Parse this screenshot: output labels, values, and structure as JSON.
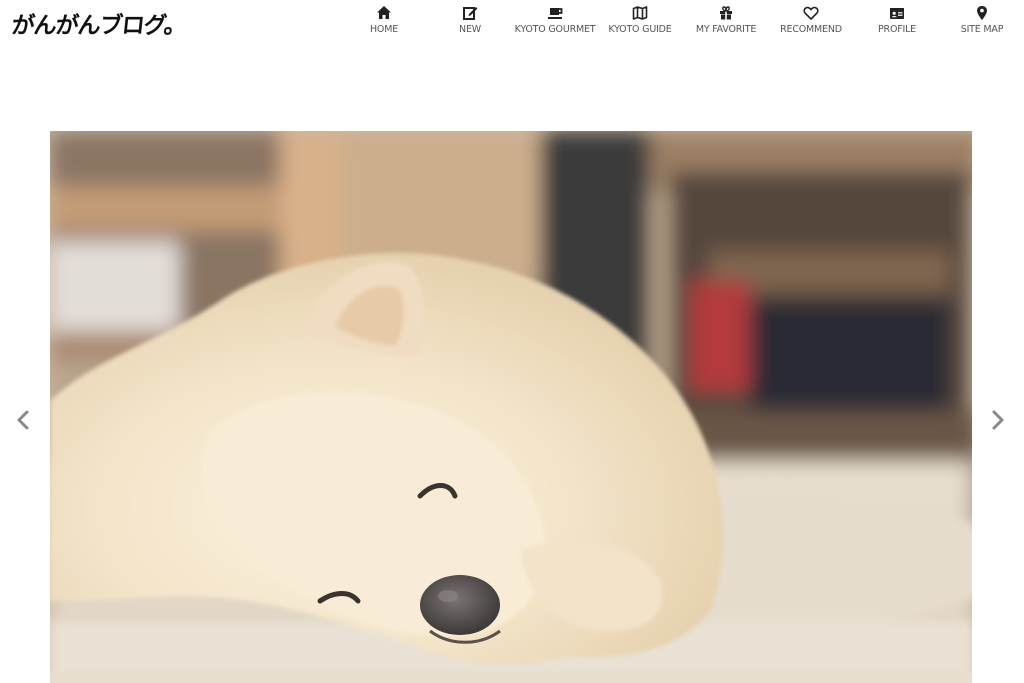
{
  "site": {
    "logo_text": "がんがんブログ。"
  },
  "nav": {
    "items": [
      {
        "label": "HOME",
        "icon": "home-icon"
      },
      {
        "label": "NEW",
        "icon": "edit-icon"
      },
      {
        "label": "KYOTO GOURMET",
        "icon": "coffee-icon"
      },
      {
        "label": "KYOTO GUIDE",
        "icon": "map-icon"
      },
      {
        "label": "MY FAVORITE",
        "icon": "gift-icon"
      },
      {
        "label": "RECOMMEND",
        "icon": "heart-icon"
      },
      {
        "label": "PROFILE",
        "icon": "id-card-icon"
      },
      {
        "label": "SITE MAP",
        "icon": "map-marker-icon"
      }
    ]
  },
  "slider": {
    "image_subject": "sleeping white pomeranian dog on carpet",
    "prev_icon": "chevron-left-icon",
    "next_icon": "chevron-right-icon"
  },
  "colors": {
    "text": "#555555",
    "icon": "#222222",
    "arrow": "#888888"
  }
}
